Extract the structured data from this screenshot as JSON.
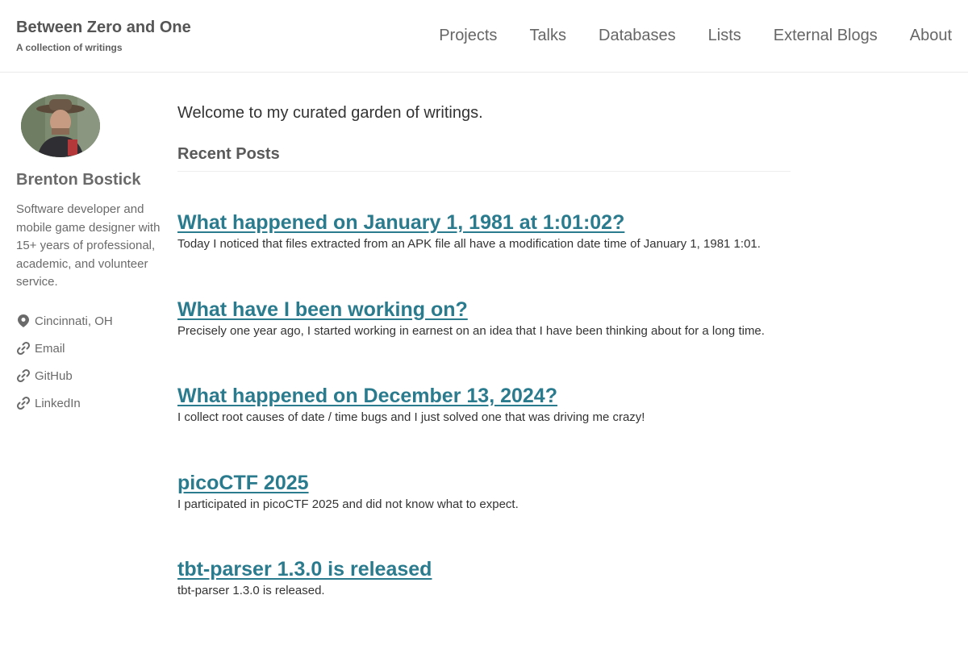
{
  "site": {
    "title": "Between Zero and One",
    "subtitle": "A collection of writings"
  },
  "nav": {
    "items": [
      {
        "label": "Projects"
      },
      {
        "label": "Talks"
      },
      {
        "label": "Databases"
      },
      {
        "label": "Lists"
      },
      {
        "label": "External Blogs"
      },
      {
        "label": "About"
      }
    ]
  },
  "author": {
    "name": "Brenton Bostick",
    "bio": "Software developer and mobile game designer with 15+ years of professional, academic, and volunteer service.",
    "links": [
      {
        "icon": "map-marker-icon",
        "label": "Cincinnati, OH"
      },
      {
        "icon": "link-icon",
        "label": "Email"
      },
      {
        "icon": "link-icon",
        "label": "GitHub"
      },
      {
        "icon": "link-icon",
        "label": "LinkedIn"
      }
    ]
  },
  "main": {
    "welcome": "Welcome to my curated garden of writings.",
    "recent_heading": "Recent Posts",
    "posts": [
      {
        "title": "What happened on January 1, 1981 at 1:01:02?",
        "excerpt": "Today I noticed that files extracted from an APK file all have a modification date time of January 1, 1981 1:01."
      },
      {
        "title": "What have I been working on?",
        "excerpt": "Precisely one year ago, I started working in earnest on an idea that I have been thinking about for a long time."
      },
      {
        "title": "What happened on December 13, 2024?",
        "excerpt": "I collect root causes of date / time bugs and I just solved one that was driving me crazy!"
      },
      {
        "title": "picoCTF 2025",
        "excerpt": "I participated in picoCTF 2025 and did not know what to expect."
      },
      {
        "title": "tbt-parser 1.3.0 is released",
        "excerpt": "tbt-parser 1.3.0 is released."
      }
    ]
  },
  "colors": {
    "link": "#2b7b8e",
    "text": "#333333",
    "muted": "#6a6a6a",
    "border": "#eaeaea"
  }
}
